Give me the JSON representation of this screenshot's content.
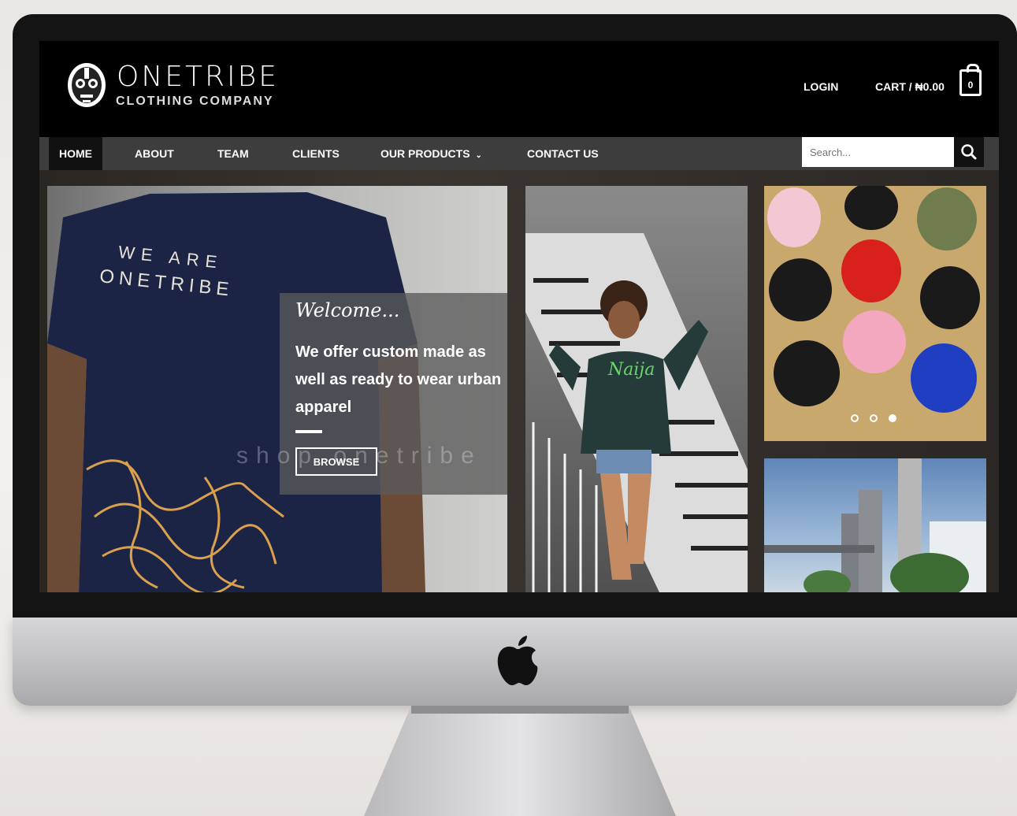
{
  "brand": {
    "name": "ONETRIBE",
    "subtitle": "CLOTHING COMPANY"
  },
  "header": {
    "login_label": "LOGIN",
    "cart_label": "CART / ₦0.00",
    "cart_count": "0"
  },
  "nav": {
    "items": [
      {
        "label": "HOME",
        "active": true
      },
      {
        "label": "ABOUT"
      },
      {
        "label": "TEAM"
      },
      {
        "label": "CLIENTS"
      },
      {
        "label": "OUR PRODUCTS"
      },
      {
        "label": "CONTACT US"
      }
    ]
  },
  "search": {
    "placeholder": "Search..."
  },
  "hero": {
    "welcome": "Welcome...",
    "tagline": "We offer custom made as well as ready to wear urban apparel",
    "browse_label": "BROWSE",
    "watermark": "shop onetribe"
  },
  "shirt_print": {
    "line1": "WE ARE",
    "line2": "ONETRIBE"
  },
  "slider": {
    "count": 3,
    "active_index": 2
  },
  "colors": {
    "nav_bg": "#3d3d3d",
    "header_bg": "#000000",
    "overlay": "#5a5a5a"
  },
  "icons": [
    "tribal-mask-logo-icon",
    "cart-bag-icon",
    "search-icon",
    "chevron-down-icon",
    "apple-logo-icon"
  ]
}
